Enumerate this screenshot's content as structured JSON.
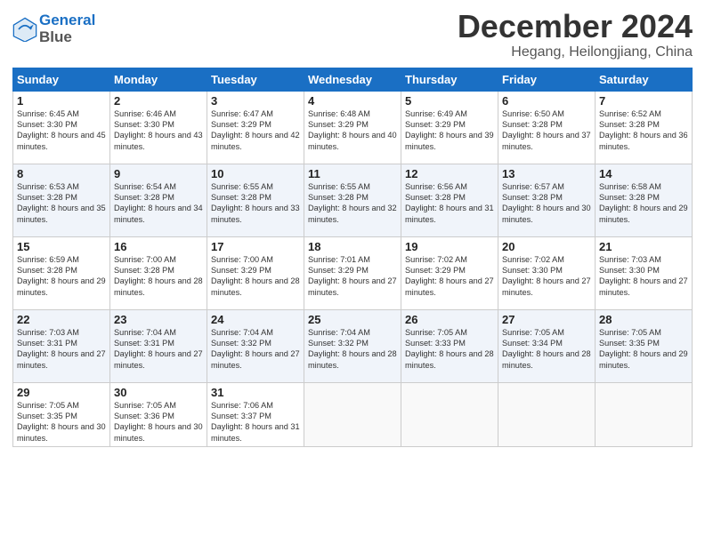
{
  "header": {
    "logo_line1": "General",
    "logo_line2": "Blue",
    "month_title": "December 2024",
    "subtitle": "Hegang, Heilongjiang, China"
  },
  "days_of_week": [
    "Sunday",
    "Monday",
    "Tuesday",
    "Wednesday",
    "Thursday",
    "Friday",
    "Saturday"
  ],
  "weeks": [
    [
      {
        "day": "1",
        "sunrise": "Sunrise: 6:45 AM",
        "sunset": "Sunset: 3:30 PM",
        "daylight": "Daylight: 8 hours and 45 minutes."
      },
      {
        "day": "2",
        "sunrise": "Sunrise: 6:46 AM",
        "sunset": "Sunset: 3:30 PM",
        "daylight": "Daylight: 8 hours and 43 minutes."
      },
      {
        "day": "3",
        "sunrise": "Sunrise: 6:47 AM",
        "sunset": "Sunset: 3:29 PM",
        "daylight": "Daylight: 8 hours and 42 minutes."
      },
      {
        "day": "4",
        "sunrise": "Sunrise: 6:48 AM",
        "sunset": "Sunset: 3:29 PM",
        "daylight": "Daylight: 8 hours and 40 minutes."
      },
      {
        "day": "5",
        "sunrise": "Sunrise: 6:49 AM",
        "sunset": "Sunset: 3:29 PM",
        "daylight": "Daylight: 8 hours and 39 minutes."
      },
      {
        "day": "6",
        "sunrise": "Sunrise: 6:50 AM",
        "sunset": "Sunset: 3:28 PM",
        "daylight": "Daylight: 8 hours and 37 minutes."
      },
      {
        "day": "7",
        "sunrise": "Sunrise: 6:52 AM",
        "sunset": "Sunset: 3:28 PM",
        "daylight": "Daylight: 8 hours and 36 minutes."
      }
    ],
    [
      {
        "day": "8",
        "sunrise": "Sunrise: 6:53 AM",
        "sunset": "Sunset: 3:28 PM",
        "daylight": "Daylight: 8 hours and 35 minutes."
      },
      {
        "day": "9",
        "sunrise": "Sunrise: 6:54 AM",
        "sunset": "Sunset: 3:28 PM",
        "daylight": "Daylight: 8 hours and 34 minutes."
      },
      {
        "day": "10",
        "sunrise": "Sunrise: 6:55 AM",
        "sunset": "Sunset: 3:28 PM",
        "daylight": "Daylight: 8 hours and 33 minutes."
      },
      {
        "day": "11",
        "sunrise": "Sunrise: 6:55 AM",
        "sunset": "Sunset: 3:28 PM",
        "daylight": "Daylight: 8 hours and 32 minutes."
      },
      {
        "day": "12",
        "sunrise": "Sunrise: 6:56 AM",
        "sunset": "Sunset: 3:28 PM",
        "daylight": "Daylight: 8 hours and 31 minutes."
      },
      {
        "day": "13",
        "sunrise": "Sunrise: 6:57 AM",
        "sunset": "Sunset: 3:28 PM",
        "daylight": "Daylight: 8 hours and 30 minutes."
      },
      {
        "day": "14",
        "sunrise": "Sunrise: 6:58 AM",
        "sunset": "Sunset: 3:28 PM",
        "daylight": "Daylight: 8 hours and 29 minutes."
      }
    ],
    [
      {
        "day": "15",
        "sunrise": "Sunrise: 6:59 AM",
        "sunset": "Sunset: 3:28 PM",
        "daylight": "Daylight: 8 hours and 29 minutes."
      },
      {
        "day": "16",
        "sunrise": "Sunrise: 7:00 AM",
        "sunset": "Sunset: 3:28 PM",
        "daylight": "Daylight: 8 hours and 28 minutes."
      },
      {
        "day": "17",
        "sunrise": "Sunrise: 7:00 AM",
        "sunset": "Sunset: 3:29 PM",
        "daylight": "Daylight: 8 hours and 28 minutes."
      },
      {
        "day": "18",
        "sunrise": "Sunrise: 7:01 AM",
        "sunset": "Sunset: 3:29 PM",
        "daylight": "Daylight: 8 hours and 27 minutes."
      },
      {
        "day": "19",
        "sunrise": "Sunrise: 7:02 AM",
        "sunset": "Sunset: 3:29 PM",
        "daylight": "Daylight: 8 hours and 27 minutes."
      },
      {
        "day": "20",
        "sunrise": "Sunrise: 7:02 AM",
        "sunset": "Sunset: 3:30 PM",
        "daylight": "Daylight: 8 hours and 27 minutes."
      },
      {
        "day": "21",
        "sunrise": "Sunrise: 7:03 AM",
        "sunset": "Sunset: 3:30 PM",
        "daylight": "Daylight: 8 hours and 27 minutes."
      }
    ],
    [
      {
        "day": "22",
        "sunrise": "Sunrise: 7:03 AM",
        "sunset": "Sunset: 3:31 PM",
        "daylight": "Daylight: 8 hours and 27 minutes."
      },
      {
        "day": "23",
        "sunrise": "Sunrise: 7:04 AM",
        "sunset": "Sunset: 3:31 PM",
        "daylight": "Daylight: 8 hours and 27 minutes."
      },
      {
        "day": "24",
        "sunrise": "Sunrise: 7:04 AM",
        "sunset": "Sunset: 3:32 PM",
        "daylight": "Daylight: 8 hours and 27 minutes."
      },
      {
        "day": "25",
        "sunrise": "Sunrise: 7:04 AM",
        "sunset": "Sunset: 3:32 PM",
        "daylight": "Daylight: 8 hours and 28 minutes."
      },
      {
        "day": "26",
        "sunrise": "Sunrise: 7:05 AM",
        "sunset": "Sunset: 3:33 PM",
        "daylight": "Daylight: 8 hours and 28 minutes."
      },
      {
        "day": "27",
        "sunrise": "Sunrise: 7:05 AM",
        "sunset": "Sunset: 3:34 PM",
        "daylight": "Daylight: 8 hours and 28 minutes."
      },
      {
        "day": "28",
        "sunrise": "Sunrise: 7:05 AM",
        "sunset": "Sunset: 3:35 PM",
        "daylight": "Daylight: 8 hours and 29 minutes."
      }
    ],
    [
      {
        "day": "29",
        "sunrise": "Sunrise: 7:05 AM",
        "sunset": "Sunset: 3:35 PM",
        "daylight": "Daylight: 8 hours and 30 minutes."
      },
      {
        "day": "30",
        "sunrise": "Sunrise: 7:05 AM",
        "sunset": "Sunset: 3:36 PM",
        "daylight": "Daylight: 8 hours and 30 minutes."
      },
      {
        "day": "31",
        "sunrise": "Sunrise: 7:06 AM",
        "sunset": "Sunset: 3:37 PM",
        "daylight": "Daylight: 8 hours and 31 minutes."
      },
      null,
      null,
      null,
      null
    ]
  ]
}
